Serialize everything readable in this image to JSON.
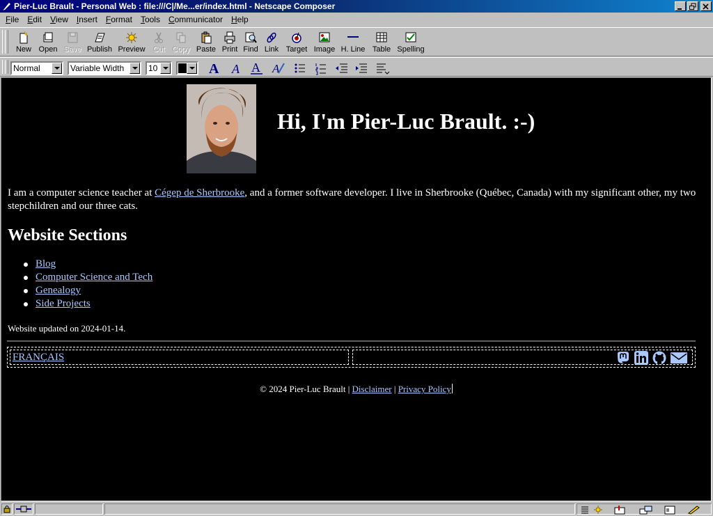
{
  "window": {
    "title": "Pier-Luc Brault - Personal Web : file:///C|/Me...er/index.html - Netscape Composer"
  },
  "menu": [
    "File",
    "Edit",
    "View",
    "Insert",
    "Format",
    "Tools",
    "Communicator",
    "Help"
  ],
  "toolbar": {
    "buttons": [
      {
        "label": "New",
        "icon": "new-page-icon",
        "enabled": true
      },
      {
        "label": "Open",
        "icon": "open-folder-icon",
        "enabled": true
      },
      {
        "label": "Save",
        "icon": "save-disk-icon",
        "enabled": false
      },
      {
        "label": "Publish",
        "icon": "publish-icon",
        "enabled": true
      },
      {
        "label": "Preview",
        "icon": "preview-icon",
        "enabled": true
      },
      {
        "label": "Cut",
        "icon": "cut-icon",
        "enabled": false
      },
      {
        "label": "Copy",
        "icon": "copy-icon",
        "enabled": false
      },
      {
        "label": "Paste",
        "icon": "paste-icon",
        "enabled": true
      },
      {
        "label": "Print",
        "icon": "print-icon",
        "enabled": true
      },
      {
        "label": "Find",
        "icon": "find-icon",
        "enabled": true
      },
      {
        "label": "Link",
        "icon": "link-icon",
        "enabled": true
      },
      {
        "label": "Target",
        "icon": "target-icon",
        "enabled": true
      },
      {
        "label": "Image",
        "icon": "image-icon",
        "enabled": true
      },
      {
        "label": "H. Line",
        "icon": "hline-icon",
        "enabled": true
      },
      {
        "label": "Table",
        "icon": "table-icon",
        "enabled": true
      },
      {
        "label": "Spelling",
        "icon": "spelling-icon",
        "enabled": true
      }
    ]
  },
  "format_toolbar": {
    "paragraph_style": "Normal",
    "font": "Variable Width",
    "font_size": "10",
    "text_color": "#000000"
  },
  "page": {
    "headline": "Hi, I'm Pier-Luc Brault. :-)",
    "intro_before_link": "I am a computer science teacher at ",
    "intro_link": "Cégep de Sherbrooke",
    "intro_after_link": ", and a former software developer. I live in Sherbrooke (Québec, Canada) with my significant other, my two stepchildren and our three cats.",
    "sections_title": "Website Sections",
    "sections": [
      "Blog",
      "Computer Science and Tech",
      "Genealogy",
      "Side Projects"
    ],
    "updated": "Website updated on 2024-01-14.",
    "language_link": "FRANÇAIS",
    "social_icons": [
      "mastodon-icon",
      "linkedin-icon",
      "github-icon",
      "email-icon"
    ],
    "copyright": "© 2024 Pier-Luc Brault",
    "separator": "|",
    "disclaimer": "Disclaimer",
    "privacy": "Privacy Policy"
  },
  "colors": {
    "page_background": "#000000",
    "page_text": "#ffffff",
    "link": "#a8c8ff",
    "titlebar": "#000080"
  }
}
